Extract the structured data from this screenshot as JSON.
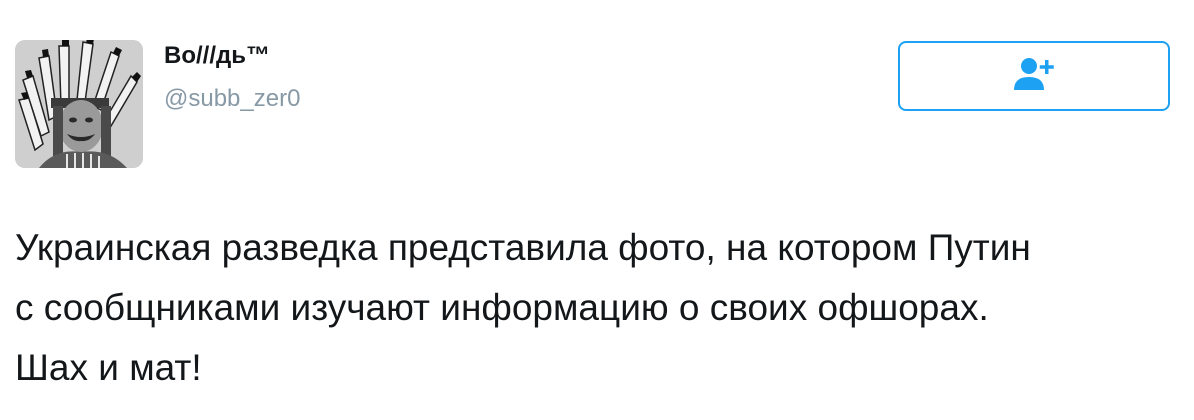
{
  "user": {
    "display_name": "Во///дь™",
    "handle": "@subb_zer0"
  },
  "follow_button": {
    "icon": "follow-person-plus-icon",
    "color": "#1da1f2"
  },
  "tweet": {
    "text": "Украинская разведка представила фото, на котором Путин\nс сообщниками изучают информацию о своих офшорах.\nШах и мат!"
  },
  "colors": {
    "text": "#14171a",
    "secondary": "#8899a6",
    "accent": "#1da1f2"
  }
}
